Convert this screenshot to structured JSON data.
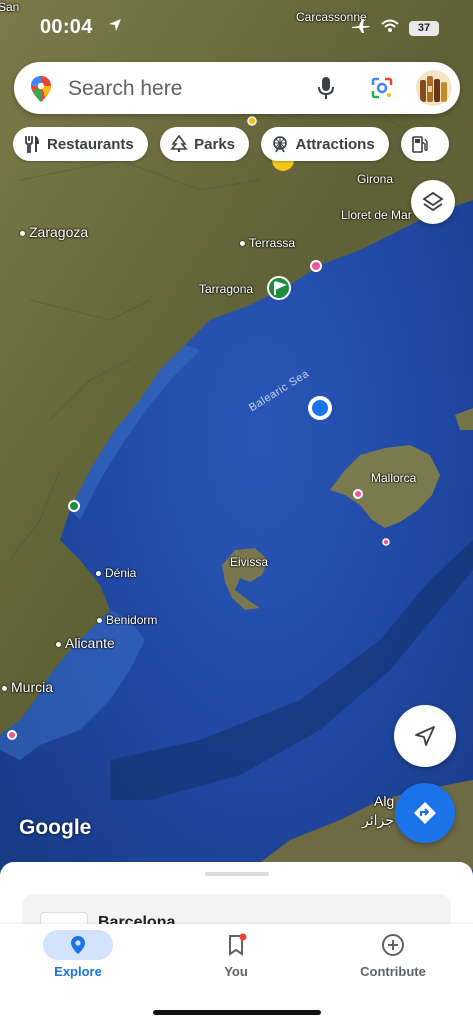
{
  "status_bar": {
    "time": "00:04",
    "battery": "37"
  },
  "search": {
    "placeholder": "Search here"
  },
  "chips": [
    {
      "label": "Restaurants",
      "icon": "fork-knife-icon"
    },
    {
      "label": "Parks",
      "icon": "tree-icon"
    },
    {
      "label": "Attractions",
      "icon": "ferris-wheel-icon"
    },
    {
      "label": "",
      "icon": "gas-station-icon"
    }
  ],
  "map": {
    "labels": {
      "san": "San",
      "carcassonne": "Carcassonne",
      "girona": "Girona",
      "lloret": "Lloret de Mar",
      "zaragoza": "Zaragoza",
      "terrassa": "Terrassa",
      "tarragona": "Tarragona",
      "balearic_sea": "Balearic Sea",
      "mallorca": "Mallorca",
      "eivissa": "Eivissa",
      "denia": "Dénia",
      "benidorm": "Benidorm",
      "alicante": "Alicante",
      "murcia": "Murcia",
      "algiers": "Alg",
      "algiers_ar": "جزائر"
    },
    "attribution": "Google"
  },
  "sheet": {
    "card_title": "Barcelona"
  },
  "nav": {
    "explore": "Explore",
    "you": "You",
    "contribute": "Contribute"
  },
  "colors": {
    "accent": "#1a73e8",
    "sea": "#1d3f8f",
    "land": "#6b6a3e",
    "you_badge": "#ea4335"
  }
}
